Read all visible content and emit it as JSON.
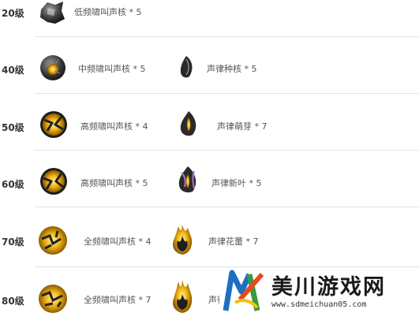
{
  "rows": [
    {
      "level": "20级",
      "item1": "低频啸叫声核 * 5",
      "item2": ""
    },
    {
      "level": "40级",
      "item1": "中频啸叫声核 * 5",
      "item2": "声律种核 * 5"
    },
    {
      "level": "50级",
      "item1": "高频啸叫声核 * 4",
      "item2": "声律萌芽 * 7"
    },
    {
      "level": "60级",
      "item1": "高频啸叫声核 * 5",
      "item2": "声律新叶 * 5"
    },
    {
      "level": "70级",
      "item1": "全频啸叫声核 * 4",
      "item2": "声律花蕾 * 7"
    },
    {
      "level": "80级",
      "item1": "全频啸叫声核 * 7",
      "item2": "声律"
    }
  ],
  "icons": {
    "core_low": "low-frequency-howl-core-icon",
    "core_mid": "mid-frequency-howl-core-icon",
    "core_high": "high-frequency-howl-core-icon",
    "core_full": "full-frequency-howl-core-icon",
    "seed": "sound-seed-core-icon",
    "sprout": "sound-sprout-icon",
    "leaf": "sound-new-leaf-icon",
    "bud": "sound-flower-bud-icon"
  },
  "colors": {
    "gold": "#f2b514",
    "dark": "#2a2a2a",
    "purple": "#b070d0"
  },
  "watermark": {
    "title": "美川游戏网",
    "url": "www.sdmeichuan05.com"
  }
}
